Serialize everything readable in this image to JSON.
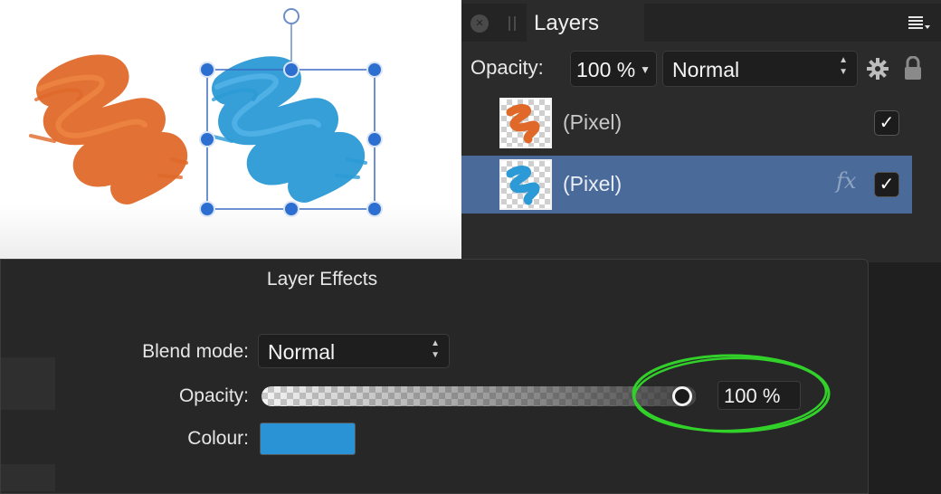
{
  "layers_panel": {
    "tab_label": "Layers",
    "opacity_label": "Opacity:",
    "opacity_value": "100 %",
    "blend_mode": "Normal",
    "icons": {
      "close": "close-icon",
      "grip": "drag-handle-icon",
      "menu": "panel-menu-icon",
      "settings": "gear-icon",
      "lock": "lock-icon"
    },
    "layers": [
      {
        "name": "(Pixel)",
        "color": "#e0692a",
        "has_fx": false,
        "visible": true,
        "selected": false
      },
      {
        "name": "(Pixel)",
        "color": "#2b9ad6",
        "has_fx": true,
        "fx_label": "fx",
        "visible": true,
        "selected": true
      }
    ]
  },
  "canvas": {
    "strokes": [
      {
        "name": "orange-brush-stroke",
        "color": "#e0692a"
      },
      {
        "name": "blue-brush-stroke",
        "color": "#2b9ad6",
        "selected": true
      }
    ],
    "selection_color": "#3b6cc4"
  },
  "layer_effects": {
    "title": "Layer Effects",
    "blend_mode_label": "Blend mode:",
    "blend_mode_value": "Normal",
    "opacity_label": "Opacity:",
    "opacity_value": "100 %",
    "opacity_fraction": 1.0,
    "colour_label": "Colour:",
    "colour_value": "#2a93d6",
    "annotation_color": "#31d12a"
  },
  "colors": {
    "panel_bg": "#2b2b2b",
    "selected_row": "#4a6b9a",
    "dialog_bg": "#272727"
  }
}
